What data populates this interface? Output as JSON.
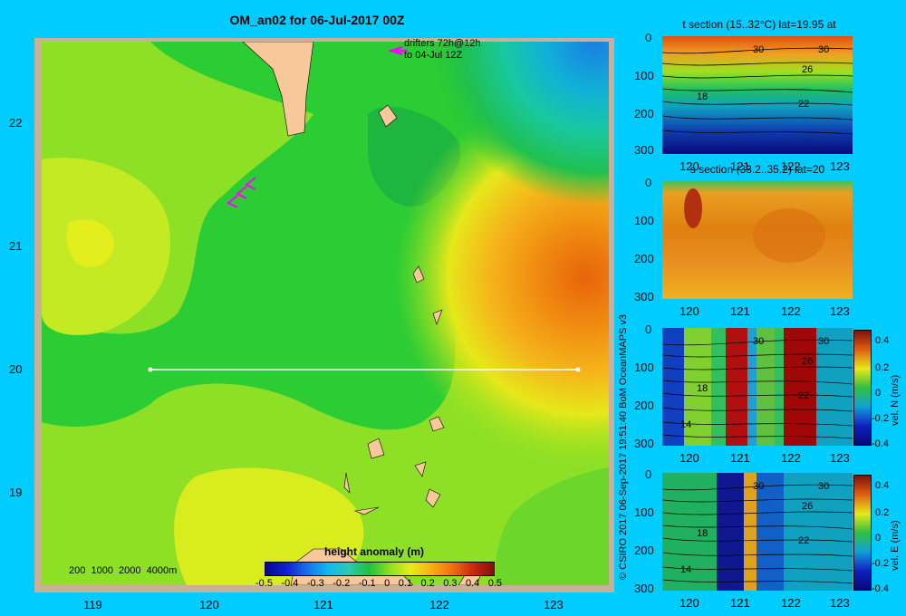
{
  "map": {
    "title": "OM_an02 for 06-Jul-2017 00Z",
    "drifters_line1": "drifters 72h@12h",
    "drifters_line2": "to 04-Jul 12Z",
    "y_ticks": [
      "22",
      "21",
      "20",
      "19"
    ],
    "x_ticks": [
      "119",
      "120",
      "121",
      "122",
      "123"
    ],
    "depth_legend": "200  1000  2000  4000m",
    "colorbar_title": "height anomaly (m)",
    "colorbar_ticks": [
      "-0.5",
      "-0.4",
      "-0.3",
      "-0.2",
      "-0.1",
      "0",
      "0.1",
      "0.2",
      "0.3",
      "0.4",
      "0.5"
    ],
    "colors": {
      "background": "#00ccff",
      "land": "#f9c89a",
      "section_line": "#ffffff",
      "drifter": "#ff00ff"
    }
  },
  "credit": "© CSIRO 2017   06-Sep-2017 19:51:40 BoM OceanMAPS v3",
  "panels": [
    {
      "title": "t section (15..32°C) lat=19.95 at",
      "y_ticks": [
        "0",
        "100",
        "200",
        "300"
      ],
      "x_ticks": [
        "120",
        "121",
        "122",
        "123"
      ],
      "contour_labels": [
        "30",
        "30",
        "26",
        "18",
        "22"
      ]
    },
    {
      "title": "s section (33.2..35.2) lat=20",
      "y_ticks": [
        "0",
        "100",
        "200",
        "300"
      ],
      "x_ticks": [
        "120",
        "121",
        "122",
        "123"
      ]
    },
    {
      "title": "",
      "y_ticks": [
        "0",
        "100",
        "200",
        "300"
      ],
      "x_ticks": [
        "120",
        "121",
        "122",
        "123"
      ],
      "contour_labels": [
        "30",
        "30",
        "26",
        "18",
        "22",
        "14"
      ],
      "colorbar_label": "vel. N (m/s)",
      "colorbar_ticks": [
        "0.4",
        "0.2",
        "0",
        "-0.2",
        "-0.4"
      ]
    },
    {
      "title": "",
      "y_ticks": [
        "0",
        "100",
        "200",
        "300"
      ],
      "x_ticks": [
        "120",
        "121",
        "122",
        "123"
      ],
      "contour_labels": [
        "30",
        "30",
        "26",
        "18",
        "22",
        "14"
      ],
      "colorbar_label": "vel. E (m/s)",
      "colorbar_ticks": [
        "0.4",
        "0.2",
        "0",
        "-0.2",
        "-0.4"
      ]
    }
  ]
}
